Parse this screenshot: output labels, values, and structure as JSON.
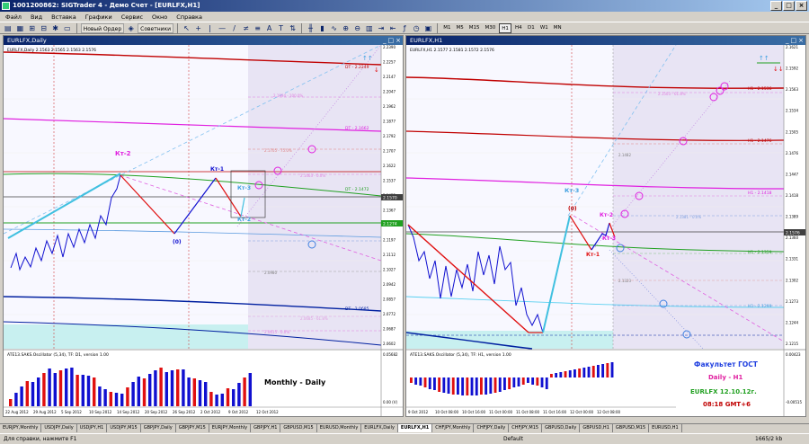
{
  "window": {
    "title": "1001200862: SIGTrader 4 - Демо Счет - [EURLFX,H1]",
    "buttons": [
      "_",
      "□",
      "×"
    ]
  },
  "menu": [
    "Файл",
    "Вид",
    "Вставка",
    "Графики",
    "Сервис",
    "Окно",
    "Справка"
  ],
  "toolbar": {
    "new_order": "Новый Ордер",
    "advisors": "Советники",
    "timeframes": [
      "M1",
      "M5",
      "M15",
      "M30",
      "H1",
      "H4",
      "D1",
      "W1",
      "MN"
    ],
    "active_timeframe": "H1"
  },
  "left_chart": {
    "title": "EURLFX,Daily",
    "info": "EURLFX,Daily 2.1563 2.1565 2.1563 2.1576",
    "indicator_label": "ATE13.SAKS.Oscillator (5,34), TF: D1, version 1.00",
    "price_labels": [
      "2.2390",
      "2.2257",
      "2.2147",
      "2.2047",
      "2.1962",
      "2.1877",
      "2.1792",
      "2.1707",
      "2.1622",
      "2.1537",
      "2.1452",
      "2.1367",
      "2.1282",
      "2.1197",
      "2.1112",
      "2.1027",
      "2.0942",
      "2.0857",
      "2.0772",
      "2.0687",
      "2.0602"
    ],
    "x_labels": [
      "22 Aug 2012",
      "29 Aug 2012",
      "5 Sep 2012",
      "10 Sep 2012",
      "14 Sep 2012",
      "20 Sep 2012",
      "26 Sep 2012",
      "2 Oct 2012",
      "9 Oct 2012",
      "12 Oct 2012"
    ],
    "osc_scale_top": "0.05682",
    "osc_scale_bottom": "0.00 (V)",
    "annotations": {
      "kt2": "Кт-2",
      "kt1": "Кт-1",
      "kt3": "Кт-3",
      "kt2b": "Кт-2",
      "zero": "(0)"
    },
    "level_labels": [
      "DT - 2.2249",
      "DT - 2.1662",
      "DT - 2.1472",
      "DT - 2.0685"
    ],
    "projection_labels": [
      "2.1994 - 100.0%",
      "2.1705 - 75.0%",
      "2.1463 - 0.0%",
      "2.0980",
      "2.0685 - 61.8%",
      "2.0615 - 0.0%"
    ],
    "current_price": "2.1570",
    "green_level": "2.1274",
    "big_label": "Monthly - Daily"
  },
  "right_chart": {
    "title": "EURLFX,H1",
    "info": "EURLFX,H1 2.1577 2.1581 2.1572 2.1576",
    "indicator_label": "ATE13.SAKS.Oscillator (5,34), TF: H1, version 1.00",
    "price_labels": [
      "2.1621",
      "2.1592",
      "2.1563",
      "2.1534",
      "2.1505",
      "2.1476",
      "2.1447",
      "2.1418",
      "2.1389",
      "2.1360",
      "2.1331",
      "2.1302",
      "2.1273",
      "2.1244",
      "2.1215"
    ],
    "x_labels": [
      "9 Oct 2012",
      "10 Oct 08:00",
      "10 Oct 16:00",
      "11 Oct 00:00",
      "11 Oct 08:00",
      "11 Oct 16:00",
      "12 Oct 00:00",
      "12 Oct 08:00"
    ],
    "osc_scale_top": "0.00423",
    "osc_scale_bottom": "-0.00515",
    "annotations": {
      "kt3": "Кт-3",
      "zero": "(0)",
      "kt2": "Кт-2",
      "kt1": "Кт-1",
      "kt3b": "Кт-3"
    },
    "level_labels": [
      "H1 - 2.1536",
      "H1 - 2.1476",
      "H1 - 2.1418",
      "H1 - 2.1359",
      "H1 - 2.1299"
    ],
    "projection_labels": [
      "2.1503 - 61.8%",
      "2.1482",
      "2.1381 - 0.0%",
      "2.1323"
    ],
    "current_price": "2.1576",
    "info_box": {
      "line1": "Факультет ГОСТ",
      "line2": "Daily - H1",
      "line3": "EURLFX 12.10.12г.",
      "line4": "08:18 GMT+6"
    }
  },
  "tabs": [
    "EURJPY,Monthly",
    "USDJPY,Daily",
    "USDJPY,H1",
    "USDJPY,M15",
    "GBPJPY,Daily",
    "GBPJPY,M15",
    "EURJPY,Monthly",
    "GBPJPY,H1",
    "GBPUSD,M15",
    "EURUSD,Monthly",
    "EURLFX,Daily",
    "EURLFX,H1",
    "CHFJPY,Monthly",
    "CHFJPY,Daily",
    "CHFJPY,M15",
    "GBPUSD,Daily",
    "GBPUSD,H1",
    "GBPUSD,M15",
    "EURUSD,H1"
  ],
  "active_tab": "EURLFX,H1",
  "status": {
    "help": "Для справки, нажмите F1",
    "profile": "Default",
    "traffic": "1665/2 kb"
  },
  "colors": {
    "bull": "#1010d0",
    "bear": "#e01010",
    "cyan": "#40c0e0",
    "magenta": "#e020e0",
    "green": "#20a020",
    "darkred": "#c00000",
    "navy": "#0a246a"
  }
}
